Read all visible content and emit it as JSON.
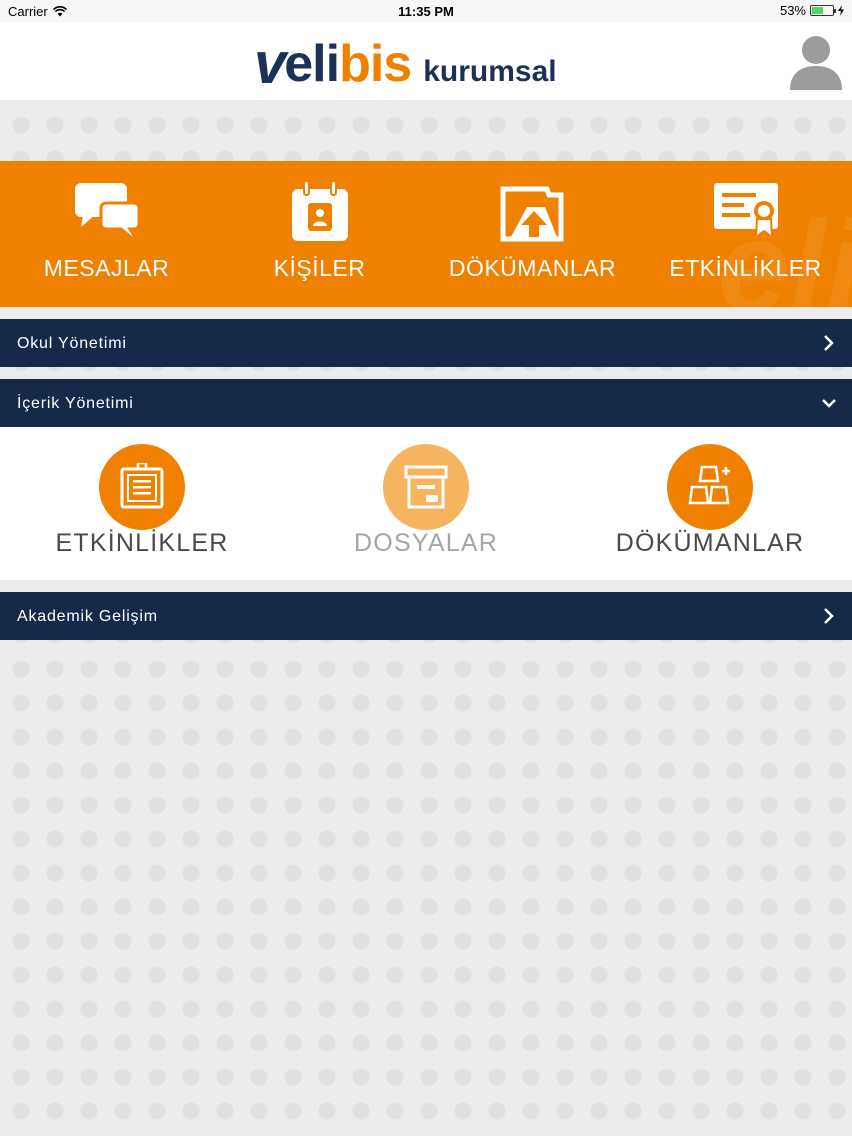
{
  "status_bar": {
    "carrier": "Carrier",
    "time": "11:35 PM",
    "battery": "53%",
    "battery_level": 0.53
  },
  "header": {
    "logo_v": "v",
    "logo_eli": "eli",
    "logo_bis": "bis",
    "logo_suffix": "kurumsal",
    "avatar_icon": "user-avatar-icon"
  },
  "top_menu": [
    {
      "label": "MESAJLAR",
      "icon": "chat-bubbles-icon"
    },
    {
      "label": "KİŞİLER",
      "icon": "contact-calendar-icon"
    },
    {
      "label": "DÖKÜMANLAR",
      "icon": "document-upload-icon"
    },
    {
      "label": "ETKİNLİKLER",
      "icon": "certificate-icon"
    }
  ],
  "sections": [
    {
      "label": "Okul Yönetimi",
      "expanded": false
    },
    {
      "label": "İçerik Yönetimi",
      "expanded": true
    },
    {
      "label": "Akademik Gelişim",
      "expanded": false
    }
  ],
  "content_items": [
    {
      "label": "ETKİNLİKLER",
      "icon": "notice-board-icon",
      "enabled": true
    },
    {
      "label": "DOSYALAR",
      "icon": "archive-box-icon",
      "enabled": false
    },
    {
      "label": "DÖKÜMANLAR",
      "icon": "stacked-blocks-icon",
      "enabled": true
    }
  ],
  "colors": {
    "orange": "#f08000",
    "navy": "#16294a",
    "orange_dim": "#f6b461"
  }
}
